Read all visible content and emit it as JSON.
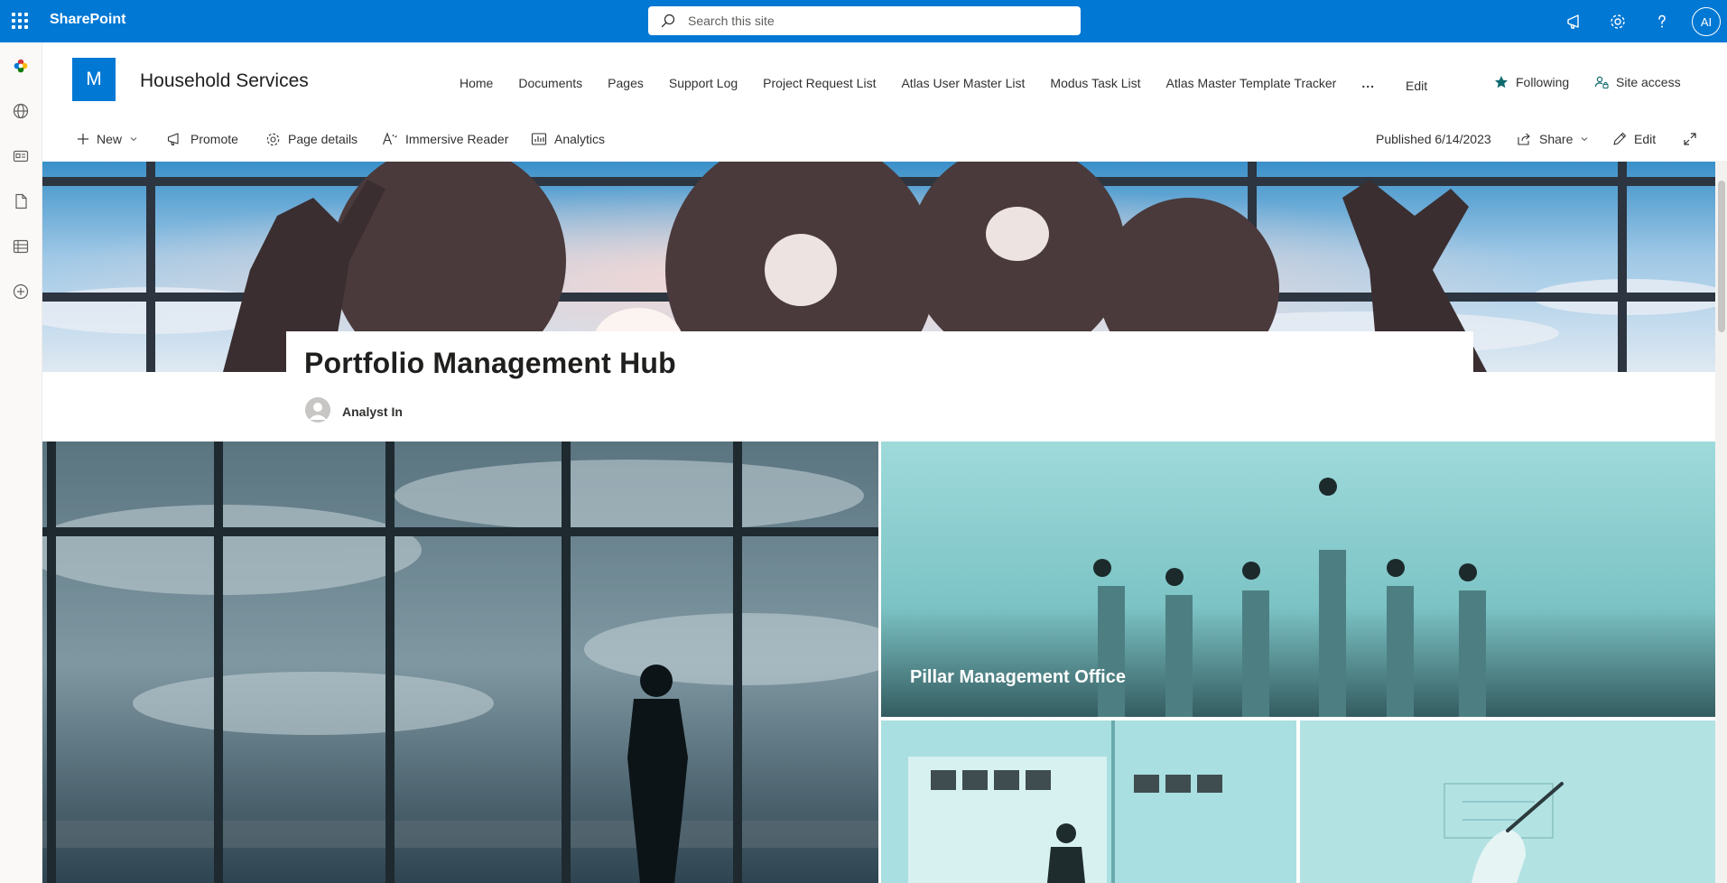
{
  "suite": {
    "brand": "SharePoint",
    "search_placeholder": "Search this site",
    "avatar_initials": "AI"
  },
  "appbar": {
    "items": [
      "sharepoint-home-icon",
      "globe-icon",
      "news-icon",
      "file-icon",
      "list-icon",
      "create-icon"
    ]
  },
  "site": {
    "logo_letter": "M",
    "title": "Household Services",
    "nav": [
      "Home",
      "Documents",
      "Pages",
      "Support Log",
      "Project Request List",
      "Atlas User Master List",
      "Modus Task List",
      "Atlas Master Template Tracker",
      "...",
      "Edit"
    ],
    "following_label": "Following",
    "site_access_label": "Site access"
  },
  "commandbar": {
    "new_label": "New",
    "promote_label": "Promote",
    "page_details_label": "Page details",
    "immersive_reader_label": "Immersive Reader",
    "analytics_label": "Analytics",
    "published_label": "Published 6/14/2023",
    "share_label": "Share",
    "edit_label": "Edit"
  },
  "page": {
    "title": "Portfolio Management Hub",
    "author": "Analyst In"
  },
  "hero": {
    "tiles": [
      {
        "label": ""
      },
      {
        "label": "Pillar Management Office"
      },
      {
        "label": ""
      },
      {
        "label": ""
      }
    ]
  },
  "colors": {
    "suite_blue": "#0078d4",
    "tile_teal": "#8fd1d2",
    "following_star": "#0f6a6e"
  }
}
